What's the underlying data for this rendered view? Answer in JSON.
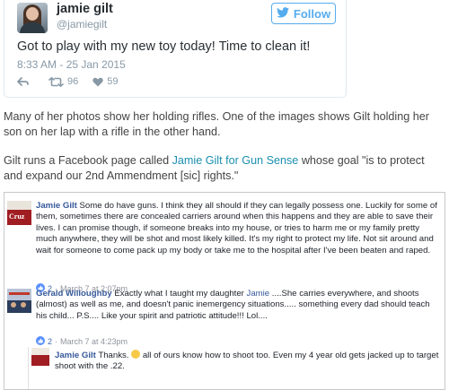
{
  "tweet": {
    "name": "jamie gilt",
    "handle": "@jamiegilt",
    "follow_label": "Follow",
    "text": "Got to play with my new toy today! Time to clean it!",
    "timestamp": "8:33 AM - 25 Jan 2015",
    "retweets": "96",
    "likes": "59"
  },
  "article": {
    "para1": "Many of her photos show her holding rifles. One of the images shows Gilt holding her son on her lap with a rifle in the other hand.",
    "para2_prefix": "Gilt runs a Facebook page called ",
    "para2_link": "Jamie Gilt for Gun Sense",
    "para2_suffix": " whose goal \"is to protect and expand our 2nd Ammendment [sic] rights.\""
  },
  "comments": [
    {
      "author": "Jamie Gilt",
      "avatar_text": "Cruz",
      "text": " Some do have guns. I think they all should if they can legally possess one. Luckily for some of them, sometimes there are concealed carriers around when this happens and they are able to save their lives. I can promise though, if someone breaks into my house, or tries to harm me or my family pretty much anywhere, they will be shot and most likely killed. It's my right to protect my life. Not sit around and wait for someone to come pack up my body or take me to the hospital after I've been beaten and raped.",
      "likes": "2",
      "time": "March 7 at 2:07pm"
    },
    {
      "author": "Gerald Willoughby",
      "text_prefix": " Exactly what I taught my daughter ",
      "mention": "Jamie",
      "text_suffix": " ....She carries everywhere, and shoots (almost) as well as me, and doesn't panic inemergency situations..... something every dad should teach his child... P.S.... Like your spirit and patriotic attitude!!! Lol....",
      "likes": "2",
      "time": "March 7 at 4:23pm"
    },
    {
      "author": "Jamie Gilt",
      "text_prefix": " Thanks. ",
      "emoji": "😊",
      "text_suffix": " all of ours know how to shoot too. Even my 4 year old gets jacked up to target shoot with the .22."
    }
  ],
  "colors": {
    "twitter_blue": "#55acee",
    "fb_name": "#365899",
    "link": "#1a8fb0"
  }
}
